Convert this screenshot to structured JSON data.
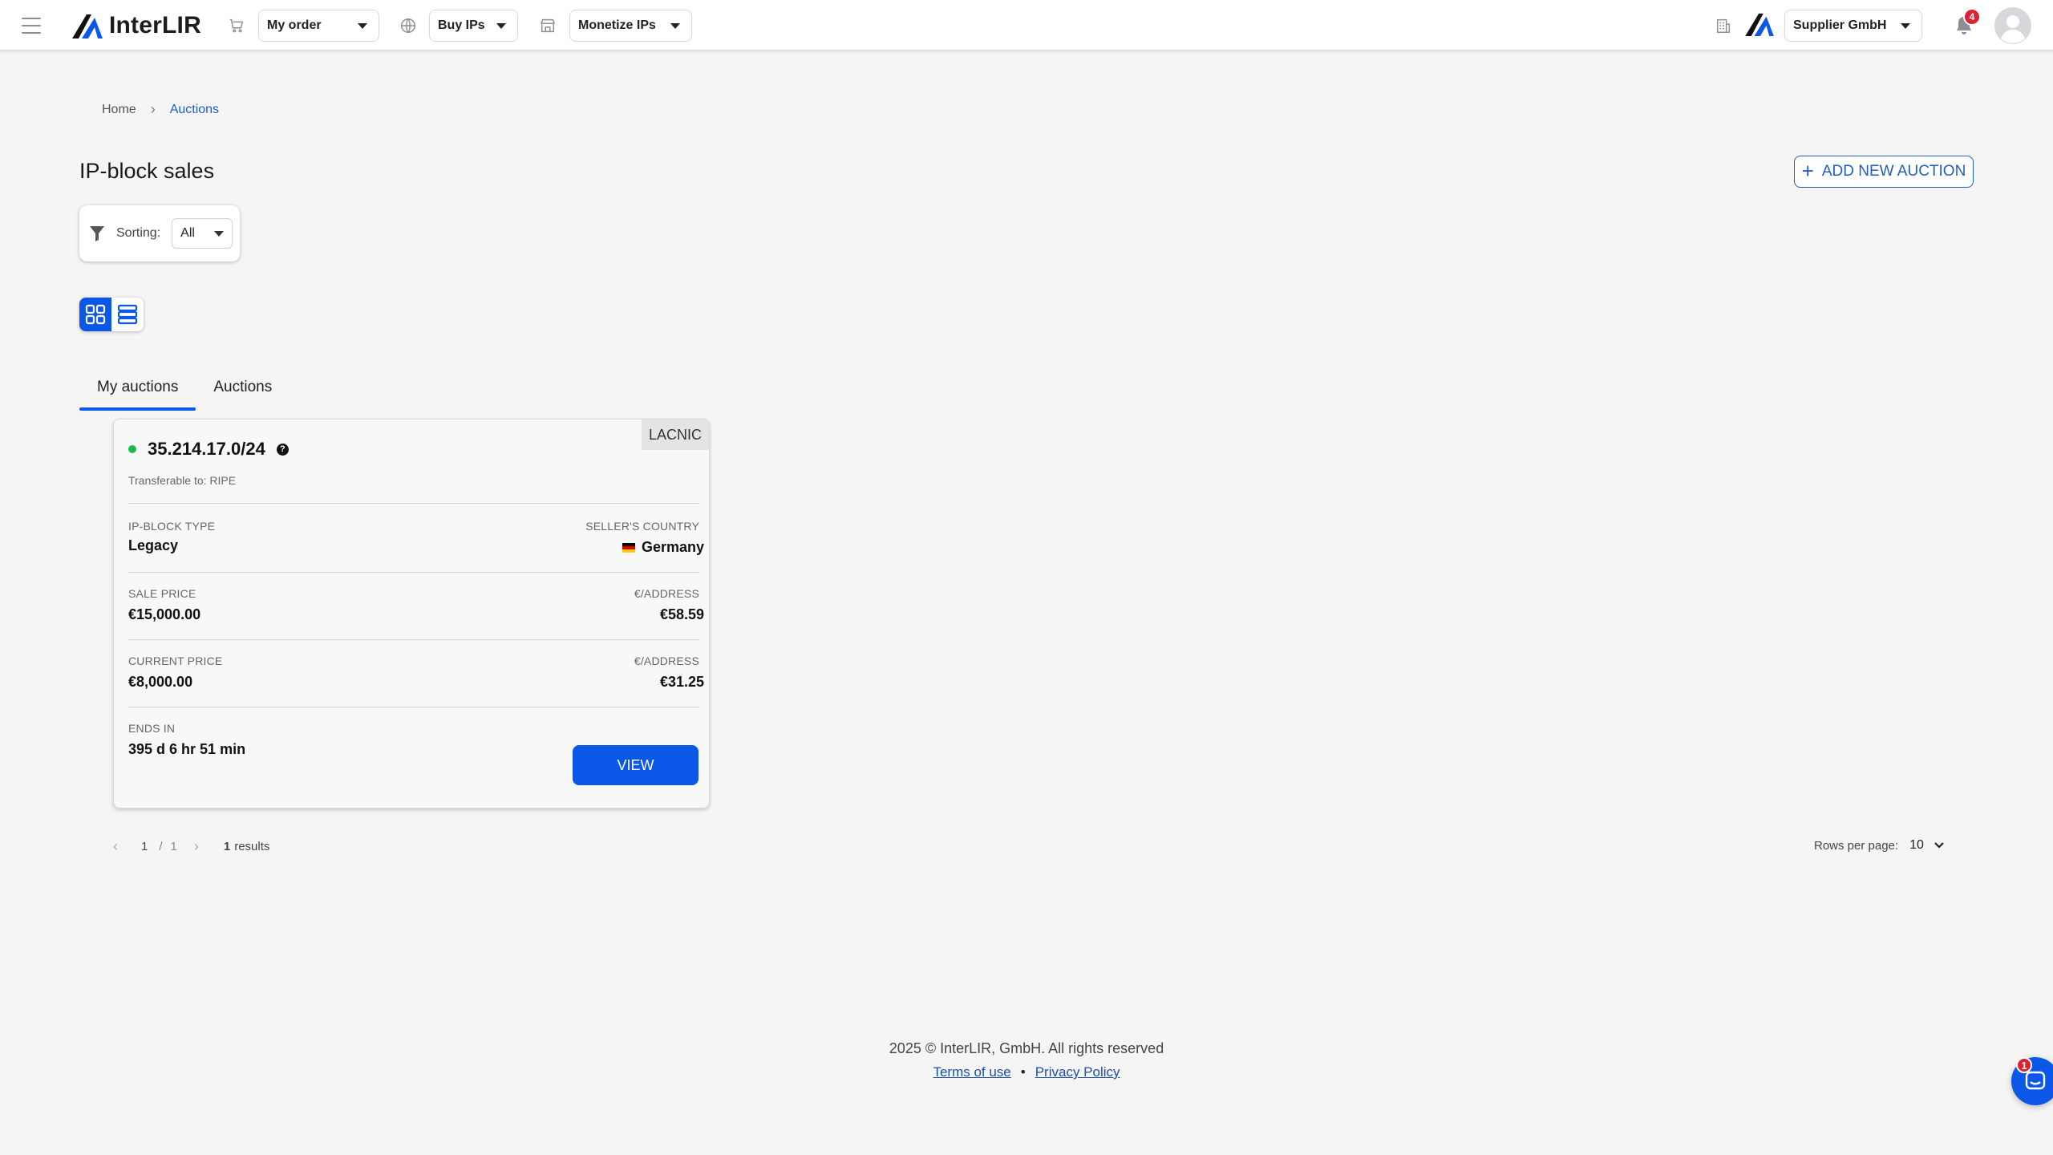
{
  "header": {
    "logo_text": "InterLIR",
    "my_order_label": "My order",
    "buy_ips_label": "Buy IPs",
    "monetize_label": "Monetize IPs",
    "company_label": "Supplier GmbH",
    "notification_count": "4"
  },
  "breadcrumb": {
    "home": "Home",
    "separator": "›",
    "current": "Auctions"
  },
  "page": {
    "title": "IP-block sales",
    "add_button": "ADD NEW AUCTION",
    "add_icon": "+"
  },
  "filter": {
    "label": "Sorting:",
    "value": "All"
  },
  "tabs": [
    {
      "label": "My auctions",
      "active": true
    },
    {
      "label": "Auctions",
      "active": false
    }
  ],
  "auction": {
    "rir": "LACNIC",
    "prefix": "35.214.17.0/24",
    "help_glyph": "?",
    "transferable": "Transferable to: RIPE",
    "type_label": "IP-BLOCK TYPE",
    "type_value": "Legacy",
    "country_label": "SELLER'S COUNTRY",
    "country_value": "Germany",
    "sale_price_label": "SALE PRICE",
    "sale_price_value": "€15,000.00",
    "sale_per_label": "€/ADDRESS",
    "sale_per_value": "€58.59",
    "current_price_label": "CURRENT PRICE",
    "current_price_value": "€8,000.00",
    "current_per_label": "€/ADDRESS",
    "current_per_value": "€31.25",
    "ends_label": "ENDS IN",
    "ends_value": "395 d 6 hr 51 min",
    "view_button": "VIEW"
  },
  "pagination": {
    "prev": "‹",
    "next": "›",
    "current_page": "1",
    "divider": "/",
    "total_pages": "1",
    "results_count": "1",
    "results_label": "results",
    "rows_label": "Rows per page:",
    "rows_value": "10"
  },
  "footer": {
    "copyright": "2025 © InterLIR, GmbH. All rights reserved",
    "terms": "Terms of use",
    "bullet": "•",
    "privacy": "Privacy Policy"
  },
  "chat": {
    "badge": "1"
  },
  "colors": {
    "primary": "#0b57e8",
    "status_active": "#1db954",
    "badge_red": "#e0202f",
    "link": "#1a5fd0"
  },
  "icons": {
    "menu": "hamburger-icon",
    "cart": "cart-icon",
    "globe": "globe-icon",
    "store": "store-icon",
    "building": "building-icon",
    "bell": "bell-icon",
    "avatar": "user-avatar-icon",
    "filter": "filter-icon",
    "grid": "grid-view-icon",
    "list": "list-view-icon",
    "chat": "chat-icon"
  }
}
